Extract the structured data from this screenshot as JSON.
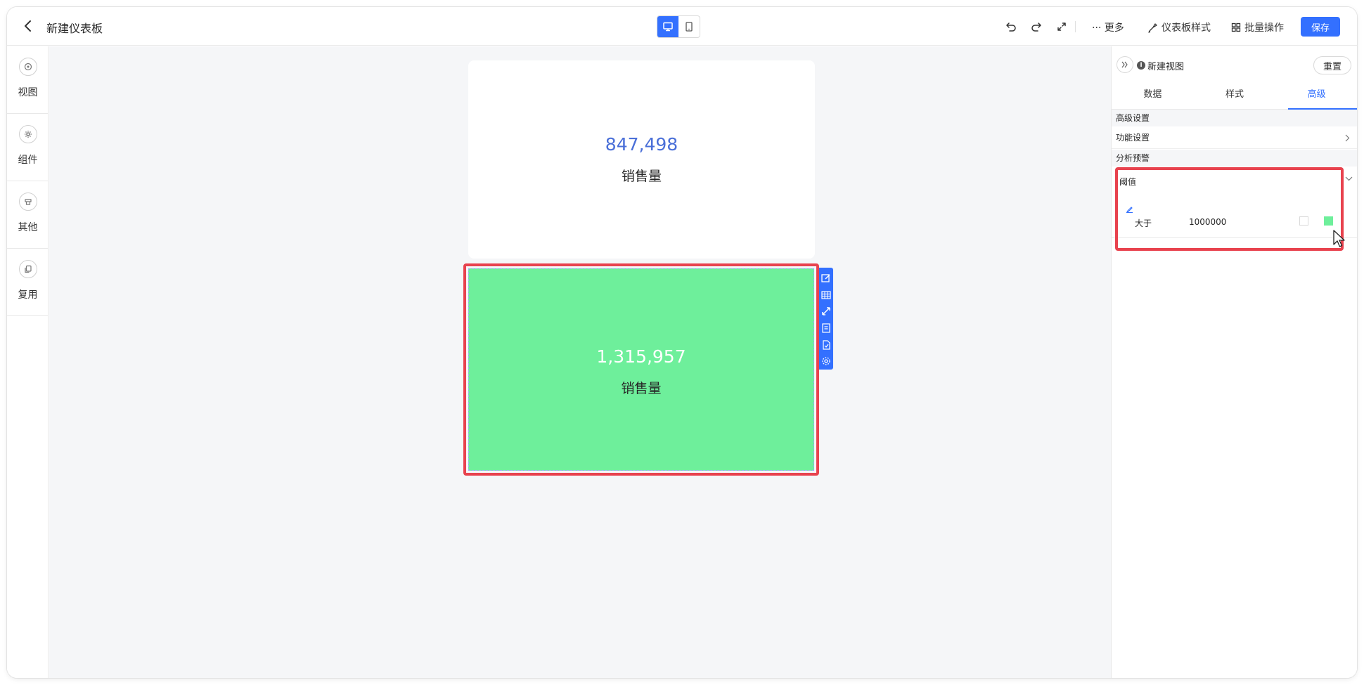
{
  "header": {
    "title": "新建仪表板",
    "actions": {
      "more": "··· 更多",
      "dashboard_style": "仪表板样式",
      "batch": "批量操作",
      "save": "保存"
    }
  },
  "sidebar": {
    "items": [
      {
        "label": "视图"
      },
      {
        "label": "组件"
      },
      {
        "label": "其他"
      },
      {
        "label": "复用"
      }
    ]
  },
  "canvas": {
    "cards": [
      {
        "value": "847,498",
        "label": "销售量",
        "value_color": "#4a6fd8"
      },
      {
        "value": "1,315,957",
        "label": "销售量",
        "background": "#6eef9b",
        "value_color": "#ffffff"
      }
    ]
  },
  "panel": {
    "title": "新建视图",
    "reset": "重置",
    "tabs": [
      "数据",
      "样式",
      "高级"
    ],
    "active_tab": "高级",
    "section_advanced": "高级设置",
    "feature_settings": "功能设置",
    "section_alert": "分析预警",
    "threshold": {
      "title": "阈值",
      "rule": {
        "operator": "大于",
        "value": "1000000",
        "color": "#6eef9b"
      }
    }
  },
  "colors": {
    "accent": "#3370ff",
    "highlight": "#e8424e",
    "canvas_bg": "#f5f6f8"
  }
}
